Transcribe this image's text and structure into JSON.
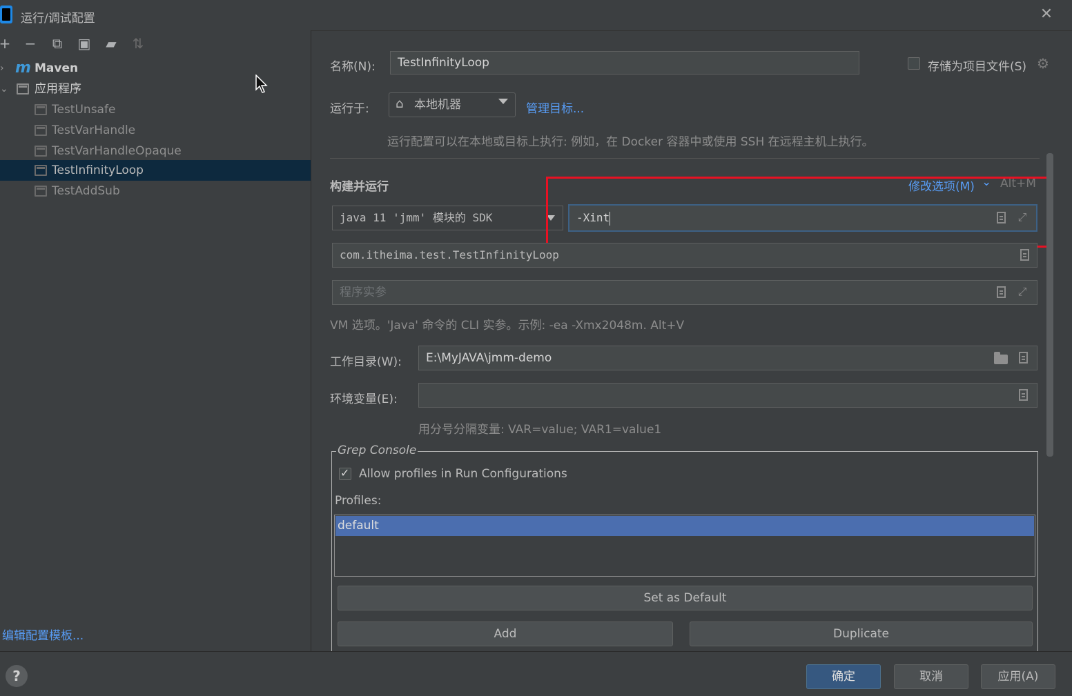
{
  "window": {
    "title": "运行/调试配置"
  },
  "left": {
    "tree": {
      "maven": "Maven",
      "application": "应用程序",
      "items": [
        "TestUnsafe",
        "TestVarHandle",
        "TestVarHandleOpaque",
        "TestInfinityLoop",
        "TestAddSub"
      ],
      "selected": "TestInfinityLoop"
    },
    "edit_templates": "编辑配置模板..."
  },
  "form": {
    "name_label": "名称(N):",
    "name_value": "TestInfinityLoop",
    "store_label": "存储为项目文件(S)",
    "run_on_label": "运行于:",
    "run_on_value": "本地机器",
    "manage_targets": "管理目标...",
    "run_on_hint": "运行配置可以在本地或目标上执行: 例如，在 Docker 容器中或使用 SSH 在远程主机上执行。",
    "build_run_title": "构建并运行",
    "modify_options": "修改选项(M)",
    "modify_shortcut": "Alt+M",
    "sdk_value": "java 11 'jmm' 模块的 SDK",
    "vm_options_value": "-Xint",
    "main_class_value": "com.itheima.test.TestInfinityLoop",
    "program_args_placeholder": "程序实参",
    "vm_hint": "VM 选项。'Java' 命令的 CLI 实参。示例: -ea -Xmx2048m. Alt+V",
    "workdir_label": "工作目录(W):",
    "workdir_value": "E:\\MyJAVA\\jmm-demo",
    "env_label": "环境变量(E):",
    "env_value": "",
    "env_hint": "用分号分隔变量: VAR=value; VAR1=value1"
  },
  "grep": {
    "title": "Grep Console",
    "allow_profiles": "Allow profiles in Run Configurations",
    "profiles_label": "Profiles:",
    "profiles": [
      "default"
    ],
    "set_default": "Set as Default",
    "add": "Add",
    "duplicate": "Duplicate"
  },
  "footer": {
    "help": "?",
    "ok": "确定",
    "cancel": "取消",
    "apply": "应用(A)"
  }
}
